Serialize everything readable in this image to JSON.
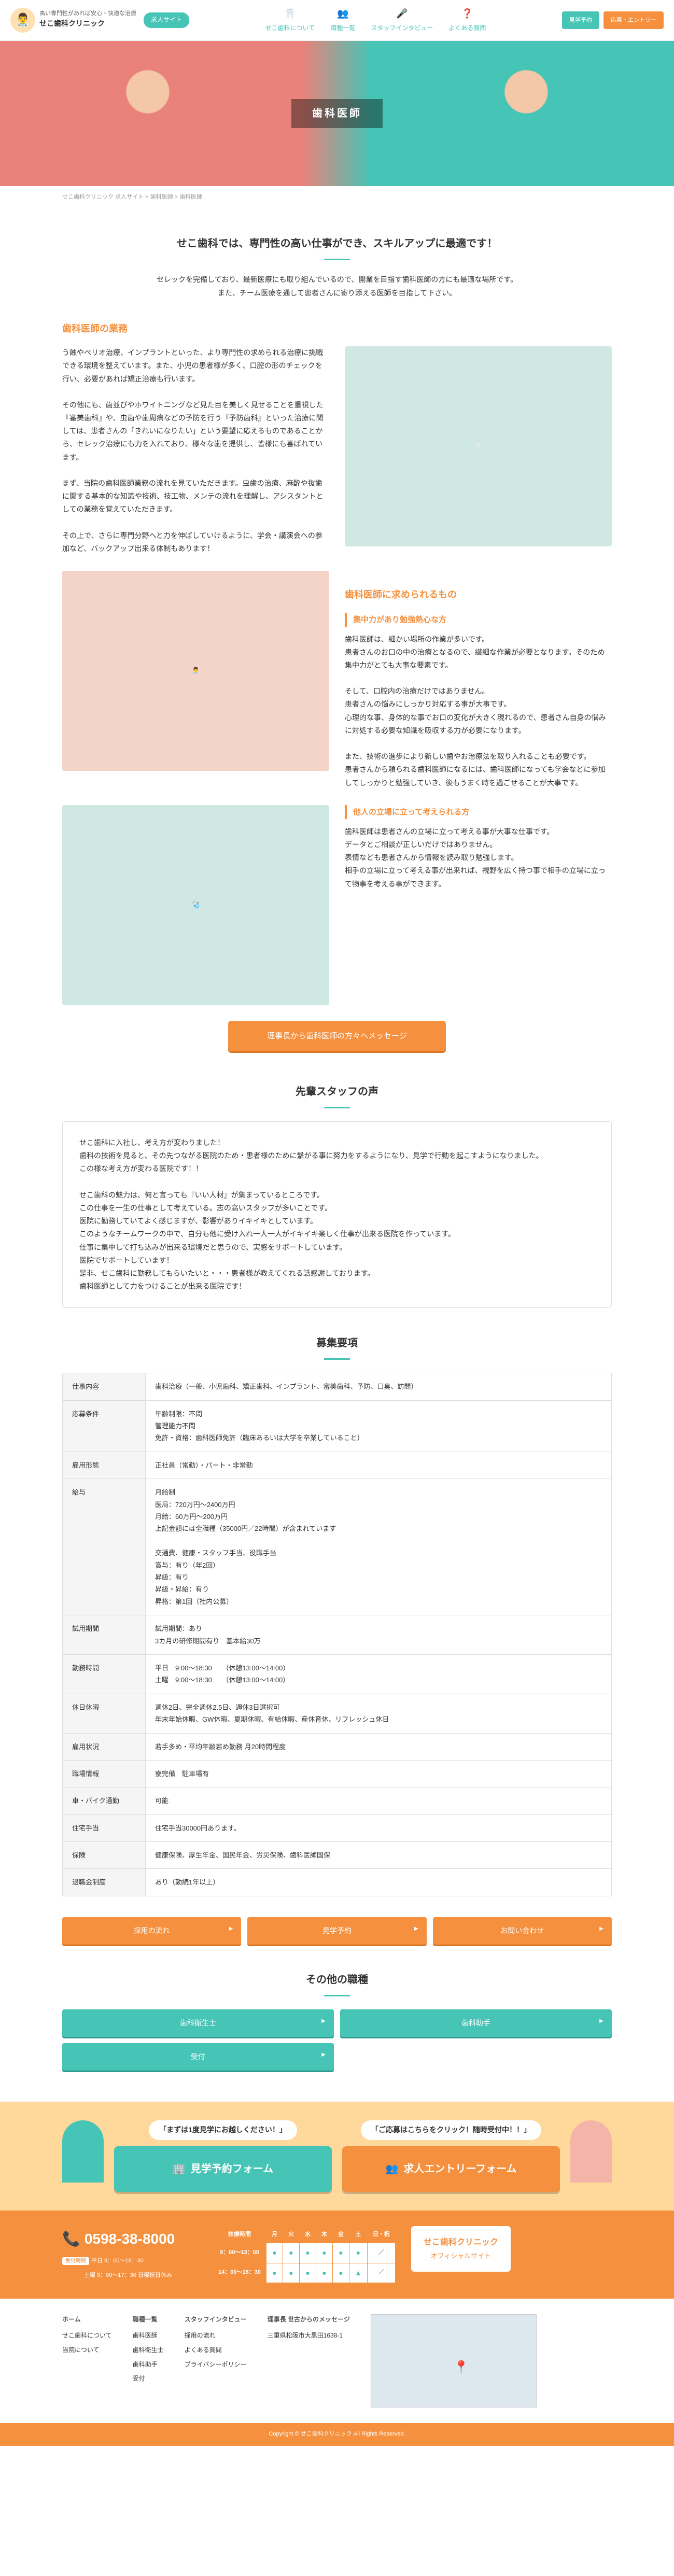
{
  "header": {
    "tagline": "高い専門性があれば安心・快適な治療",
    "clinic_name": "せこ歯科クリニック",
    "badge": "求人サイト",
    "nav": [
      {
        "label": "せこ歯科について",
        "icon": "🦷"
      },
      {
        "label": "職種一覧",
        "icon": "👥"
      },
      {
        "label": "スタッフインタビュー",
        "icon": "🎤"
      },
      {
        "label": "よくある質問",
        "icon": "❓"
      }
    ],
    "btn_visit": "見学予約",
    "btn_entry": "応募・エントリー"
  },
  "hero": {
    "title": "歯科医師"
  },
  "breadcrumb": "せこ歯科クリニック 求人サイト > 歯科医師 > 歯科医師",
  "headline": "せこ歯科では、専門性の高い仕事ができ、スキルアップに最適です！",
  "intro": "セレックを完備しており、最新医療にも取り組んでいるので、開業を目指す歯科医師の方にも最適な場所です。\nまた、チーム医療を通して患者さんに寄り添える医師を目指して下さい。",
  "duties_h": "歯科医師の業務",
  "duties_body": "う蝕やぺリオ治療、インプラントといった、より専門性の求められる治療に挑戦できる環境を整えています。また、小児の患者様が多く、口腔の形のチェックを行い、必要があれば矯正治療も行います。\n\nその他にも、歯並びやホワイトニングなど見た目を美しく見せることを重視した『審美歯科』や、虫歯や歯周病などの予防を行う『予防歯科』といった治療に関しては、患者さんの「きれいになりたい」という要望に応えるものであることから、セレック治療にも力を入れており、様々な歯を提供し、皆様にも喜ばれています。\n\nまず、当院の歯科医師業務の流れを見ていただきます。虫歯の治療、麻酔や抜歯に関する基本的な知識や技術、技工物、メンテの流れを理解し、アシスタントとしての業務を覚えていただきます。\n\nその上で、さらに専門分野へと力を伸ばしていけるように、学会・講演会への参加など、バックアップ出来る体制もあります！",
  "req_h": "歯科医師に求められるもの",
  "req_sub1": "集中力があり勉強熱心な方",
  "req_body1": "歯科医師は、細かい場所の作業が多いです。\n患者さんのお口の中の治療となるので、繊細な作業が必要となります。そのため集中力がとても大事な要素です。\n\nそして、口腔内の治療だけではありません。\n患者さんの悩みにしっかり対応する事が大事です。\n心理的な事、身体的な事でお口の変化が大きく現れるので、患者さん自身の悩みに対処する必要な知識を吸収する力が必要になります。\n\nまた、技術の進歩により新しい歯やお治療法を取り入れることも必要です。\n患者さんから頼られる歯科医師になるには、歯科医師になっても学会などに参加してしっかりと勉強していき、後もうまく時を過ごせることが大事です。",
  "req_sub2": "他人の立場に立って考えられる方",
  "req_body2": "歯科医師は患者さんの立場に立って考える事が大事な仕事です。\nデータとご相談が正しいだけではありません。\n表情なども患者さんから情報を読み取り勉強します。\n相手の立場に立って考える事が出来れば、視野を広く持つ事で相手の立場に立って物事を考える事ができます。",
  "msg_btn": "理事長から歯科医師の方々へメッセージ",
  "voice_h": "先輩スタッフの声",
  "voice_body": "せこ歯科に入社し、考え方が変わりました！\n歯科の技術を見ると、その先つながる医院のため・患者様のために繋がる事に努力をするようになり、見学で行動を起こすようになりました。\nこの様な考え方が変わる医院です！！\n\nせこ歯科の魅力は、何と言っても『いい人材』が集まっているところです。\nこの仕事を一生の仕事として考えている。志の高いスタッフが多いことです。\n医院に勤務していてよく感じますが、影響がありイキイキとしています。\nこのようなチームワークの中で、自分も他に受け入れ一人一人がイキイキ楽しく仕事が出来る医院を作っています。\n仕事に集中して打ち込みが出来る環境だと思うので、実感をサポートしています。\n医院でサポートしています！\n是非、せこ歯科に勤務してもらいたいと・・・患者様が教えてくれる話感謝しております。\n歯科医師として力をつけることが出来る医院です！",
  "recruit_h": "募集要項",
  "recruit_rows": [
    {
      "th": "仕事内容",
      "td": "歯科治療（一般、小児歯科、矯正歯科、インプラント、審美歯科、予防、口臭、訪問）"
    },
    {
      "th": "応募条件",
      "td": "年齢制限：不問\n管理能力不問\n免許・資格：歯科医師免許（臨床あるいは大学を卒業していること）"
    },
    {
      "th": "雇用形態",
      "td": "正社員（常勤）・パート・非常勤"
    },
    {
      "th": "給与",
      "td": "月給制\n医局：720万円〜2400万円\n月給：60万円〜200万円\n上記金額には全職種（35000円／22時間）が含まれています\n\n交通費、健康・スタッフ手当、役職手当\n賞与：有り（年2回）\n昇級：有り\n昇級・昇給：有り\n昇格：第1回（社内公募）"
    },
    {
      "th": "試用期間",
      "td": "試用期間：あり\n3カ月の研修期間有り　基本給30万"
    },
    {
      "th": "勤務時間",
      "td": "平日　9:00〜18:30　　（休憩13:00〜14:00）\n土曜　9:00〜18:30　　（休憩13:00〜14:00）"
    },
    {
      "th": "休日休暇",
      "td": "週休2日、完全週休2.5日、週休3日選択可\n年末年始休暇、GW休暇、夏期休暇、有給休暇、産休育休、リフレッシュ休日"
    },
    {
      "th": "雇用状況",
      "td": "若手多め・平均年齢若め勤務 月20時間程度"
    },
    {
      "th": "職場情報",
      "td": "寮完備　駐車場有"
    },
    {
      "th": "車・バイク通勤",
      "td": "可能"
    },
    {
      "th": "住宅手当",
      "td": "住宅手当30000円あります。"
    },
    {
      "th": "保険",
      "td": "健康保険、厚生年金、国民年金、労災保険、歯科医師国保"
    },
    {
      "th": "退職金制度",
      "td": "あり（勤続1年以上）"
    }
  ],
  "action_btns": [
    "採用の流れ",
    "見学予約",
    "お問い合わせ"
  ],
  "other_h": "その他の職種",
  "other_jobs": [
    "歯科衛生士",
    "歯科助手",
    "受付"
  ],
  "cta": {
    "left_label": "「まずは1度見学にお越しください！」",
    "left_btn": "見学予約フォーム",
    "right_label": "「ご応募はこちらをクリック！随時受付中！！」",
    "right_btn": "求人エントリーフォーム"
  },
  "footer": {
    "tel": "0598-38-8000",
    "hours_weekday": "平日 9：00〜18：30",
    "hours_sat": "土曜 9：00〜17：30 日曜祝日休み",
    "table_head": [
      "診療時間",
      "月",
      "火",
      "水",
      "木",
      "金",
      "土",
      "日・祝"
    ],
    "table_rows": [
      [
        "9：00〜13：00",
        "●",
        "●",
        "●",
        "●",
        "●",
        "●",
        "／"
      ],
      [
        "14：00〜18：30",
        "●",
        "●",
        "●",
        "●",
        "●",
        "▲",
        "／"
      ]
    ],
    "official": "せこ歯科クリニック",
    "official_sub": "オフィシャルサイト",
    "nav_cols": [
      {
        "h": "ホーム",
        "items": [
          "せこ歯科について",
          "当院について"
        ]
      },
      {
        "h": "職種一覧",
        "items": [
          "歯科医師",
          "歯科衛生士",
          "歯科助手",
          "受付"
        ]
      },
      {
        "h": "スタッフインタビュー",
        "items": [
          "採用の流れ",
          "よくある質問",
          "プライバシーポリシー"
        ]
      },
      {
        "h": "理事長 世古からのメッセージ",
        "items": [
          "三重県松阪市大黒田1638-1"
        ]
      }
    ],
    "copyright": "Copyright © せこ歯科クリニック All Rights Reserved."
  }
}
